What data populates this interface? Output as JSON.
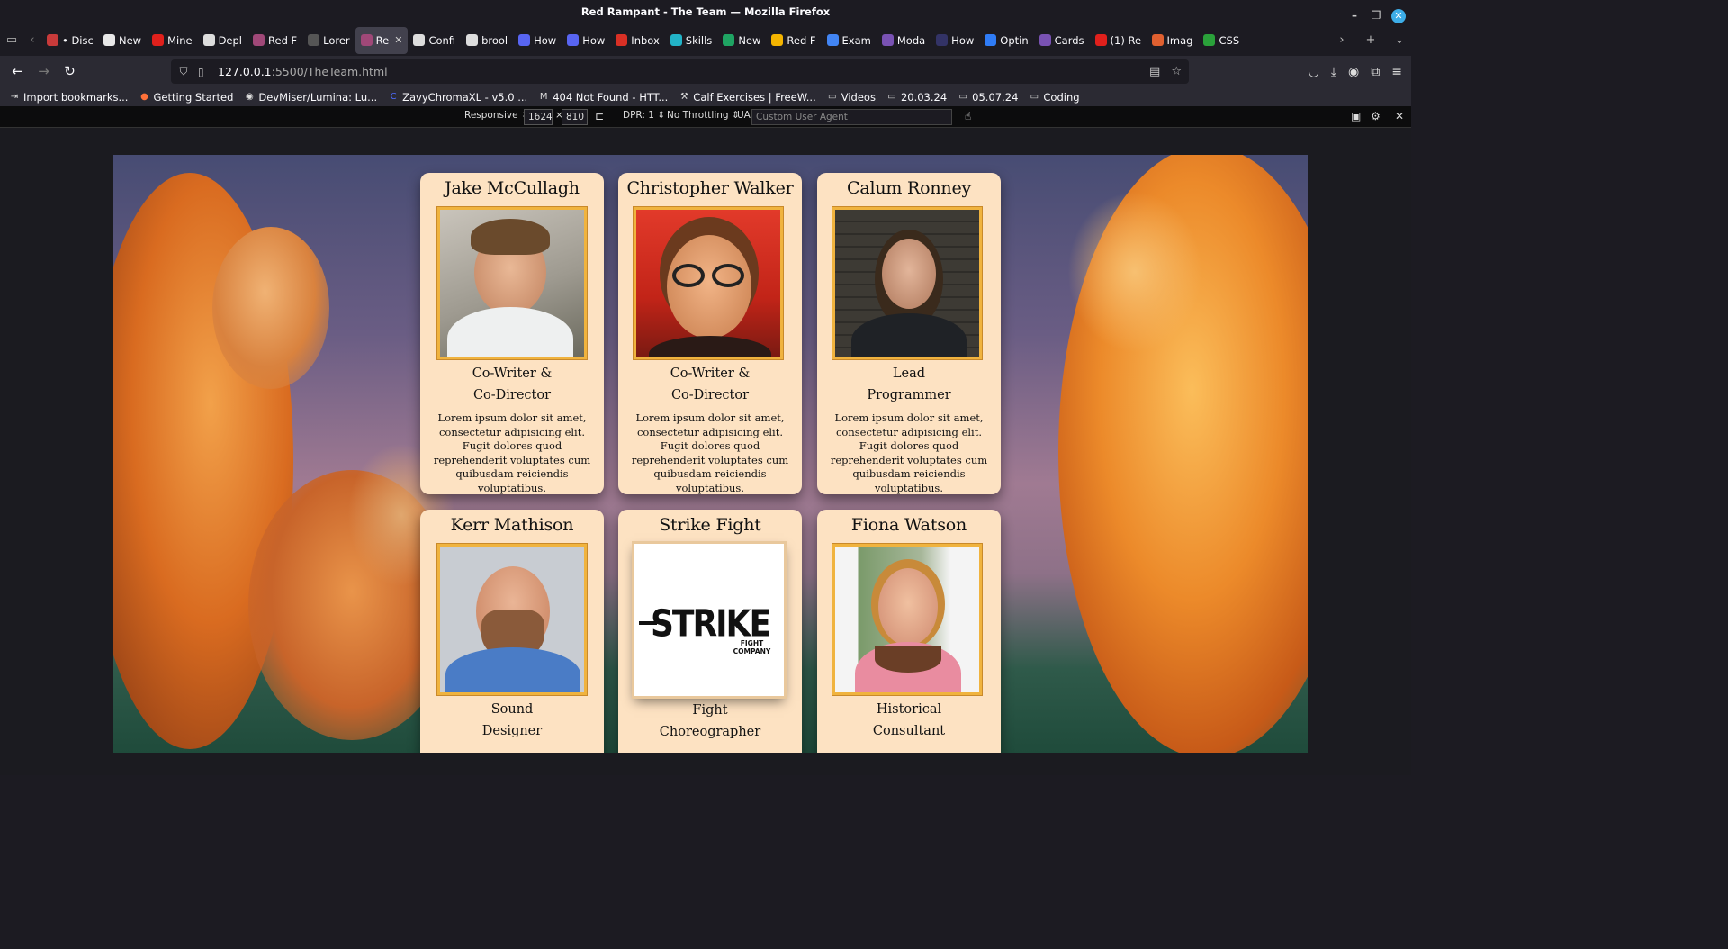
{
  "window": {
    "title": "Red Rampant - The Team — Mozilla Firefox"
  },
  "tabs": [
    {
      "label": "• Disc",
      "color": "#c83a3a"
    },
    {
      "label": "New",
      "color": "#e8e8e8"
    },
    {
      "label": "Mine",
      "color": "#e0201c"
    },
    {
      "label": "Depl",
      "color": "#dddddd"
    },
    {
      "label": "Red F",
      "color": "#a04878"
    },
    {
      "label": "Lorer",
      "color": "#555555"
    },
    {
      "label": "Re",
      "color": "#a04878",
      "active": true
    },
    {
      "label": "Confi",
      "color": "#dddddd"
    },
    {
      "label": "brool",
      "color": "#dddddd"
    },
    {
      "label": "How",
      "color": "#5865f2"
    },
    {
      "label": "How",
      "color": "#5865f2"
    },
    {
      "label": "Inbox",
      "color": "#d93025"
    },
    {
      "label": "Skills",
      "color": "#22b3c7"
    },
    {
      "label": "New",
      "color": "#1fa463"
    },
    {
      "label": "Red F",
      "color": "#f4b400"
    },
    {
      "label": "Exam",
      "color": "#4285f4"
    },
    {
      "label": "Moda",
      "color": "#7952b3"
    },
    {
      "label": "How",
      "color": "#333366"
    },
    {
      "label": "Optin",
      "color": "#2f7cf6"
    },
    {
      "label": "Cards",
      "color": "#7952b3"
    },
    {
      "label": "(1) Re",
      "color": "#e0201c"
    },
    {
      "label": "Imag",
      "color": "#e06030"
    },
    {
      "label": "CSS",
      "color": "#2aa13a"
    }
  ],
  "nav": {
    "url_host": "127.0.0.1",
    "url_path": ":5500/TheTeam.html"
  },
  "bookmarks": [
    {
      "label": "Import bookmarks...",
      "icon": "import-icon"
    },
    {
      "label": "Getting Started",
      "icon": "firefox-icon"
    },
    {
      "label": "DevMiser/Lumina: Lu...",
      "icon": "github-icon"
    },
    {
      "label": "ZavyChromaXL - v5.0 ...",
      "icon": "civitai-icon"
    },
    {
      "label": "404 Not Found - HTT...",
      "icon": "mdn-icon"
    },
    {
      "label": "Calf Exercises | FreeW...",
      "icon": "freeweights-icon"
    },
    {
      "label": "Videos",
      "icon": "folder-icon"
    },
    {
      "label": "20.03.24",
      "icon": "folder-icon"
    },
    {
      "label": "05.07.24",
      "icon": "folder-icon"
    },
    {
      "label": "Coding",
      "icon": "folder-icon"
    }
  ],
  "responsive": {
    "device": "Responsive",
    "width": "1624",
    "times": "×",
    "height": "810",
    "dpr": "DPR: 1",
    "throttling": "No Throttling",
    "ua_label": "UA:",
    "ua_placeholder": "Custom User Agent"
  },
  "team": [
    {
      "name": "Jake McCullagh",
      "role_line1": "Co-Writer &",
      "role_line2": "Co-Director",
      "description": "Lorem ipsum dolor sit amet, consectetur adipisicing elit. Fugit dolores quod reprehenderit voluptates cum quibusdam reiciendis voluptatibus."
    },
    {
      "name": "Christopher Walker",
      "role_line1": "Co-Writer &",
      "role_line2": "Co-Director",
      "description": "Lorem ipsum dolor sit amet, consectetur adipisicing elit. Fugit dolores quod reprehenderit voluptates cum quibusdam reiciendis voluptatibus."
    },
    {
      "name": "Calum Ronney",
      "role_line1": "Lead",
      "role_line2": "Programmer",
      "description": "Lorem ipsum dolor sit amet, consectetur adipisicing elit. Fugit dolores quod reprehenderit voluptates cum quibusdam reiciendis voluptatibus."
    },
    {
      "name": "Kerr Mathison",
      "role_line1": "Sound",
      "role_line2": "Designer"
    },
    {
      "name": "Strike Fight",
      "role_line1": "Fight",
      "role_line2": "Choreographer",
      "logo_text": "STRIKE",
      "logo_sub": "FIGHT COMPANY"
    },
    {
      "name": "Fiona Watson",
      "role_line1": "Historical",
      "role_line2": "Consultant"
    }
  ]
}
